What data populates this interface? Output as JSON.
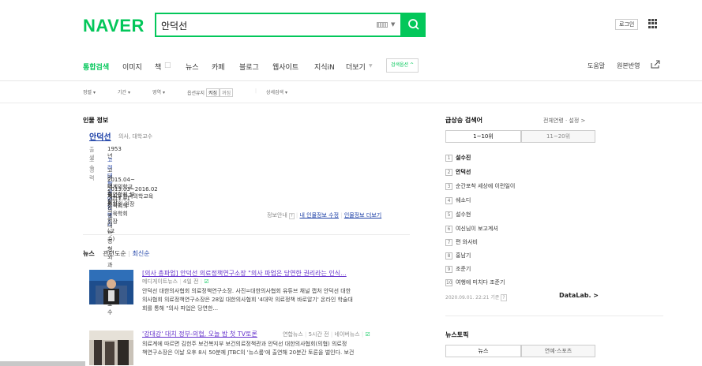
{
  "header": {
    "logo": "NAVER",
    "search_value": "안덕선",
    "login_label": "로그인"
  },
  "nav": {
    "tabs": [
      "통합검색",
      "이미지",
      "책",
      "뉴스",
      "카페",
      "블로그",
      "웹사이트",
      "지식iN",
      "더보기"
    ],
    "search_options_label": "검색옵션 ^",
    "right": [
      "도움말",
      "원본반영"
    ]
  },
  "filters": {
    "items": [
      "정렬",
      "기간",
      "영역",
      "옵션유지",
      "상세검색"
    ],
    "chip_on": "켜짐",
    "chip_off": "꺼짐"
  },
  "person": {
    "section_title": "인물 정보",
    "name": "안덕선",
    "job": "의사, 대학교수",
    "birth_label": "출생",
    "birth": "1953년",
    "affil_label": "소속",
    "affil_link": "고려대학교 안암병원",
    "affil_suffix": "(교수)",
    "career_label": "경력",
    "career": [
      "고려대학교 의과대학 성형외과교실 겸임교수",
      "2015.04~ 세계의학교육연합회 부회장",
      "2013.03~2016.02 제4대 한국의학교육평가원 원장",
      "2011.01 한국의학교육학회 회장"
    ],
    "links": {
      "info": "정보안내",
      "edit": "내 인물정보 수정",
      "more": "인물정보 더보기"
    }
  },
  "news": {
    "section": "뉴스",
    "sort_relevance": "관련도순",
    "sort_latest": "최신순",
    "items": [
      {
        "title": "[의사 총파업] 안덕선 의료정책연구소장 \"의사 파업은 당연한 권리라는 인식...",
        "source": "메디게이트뉴스",
        "time": "4일 전",
        "body1": "안덕선 대한의사협회 의료정책연구소장. 사진=대한의사협회 유튜브 채널 캡처 안덕선 대한",
        "body2": "의사협회 의료정책연구소장은 28일 대한의사협회 '4대악 의료정책 바로알기' 온라인 학술대",
        "body3": "회를 통해 \"의사 파업은 당연한..."
      },
      {
        "title": "'강대강' 대치 정부-의협, 오늘 밤 첫 TV토론",
        "source": "연합뉴스",
        "time": "5시간 전",
        "extra": "네이버뉴스",
        "body1": "의료계에 따르면 김헌주 보건복지부 보건의료정책관과 안덕선 대한의사협회(의협) 의료정",
        "body2": "책연구소장은 이날 오후 8시 50분께 JTBC의 '뉴스룸'에 출연해 20분간 토론을 벌인다. 보건"
      }
    ]
  },
  "trending": {
    "title": "급상승 검색어",
    "opts": "전체연령 · 설정 >",
    "tab1": "1~10위",
    "tab2": "11~20위",
    "items": [
      "설수진",
      "안덕선",
      "순간포착 세상에 이런일이",
      "쉐소디",
      "설수현",
      "여신님이 보고계셔",
      "편 와사비",
      "홍남기",
      "조준기",
      "여행에 미치다 조준기"
    ],
    "timestamp": "2020.09.01. 22:21 기준",
    "datalab": "DataLab. >"
  },
  "newstopic": {
    "title": "뉴스토픽",
    "tab1": "뉴스",
    "tab2": "연예·스포츠"
  }
}
